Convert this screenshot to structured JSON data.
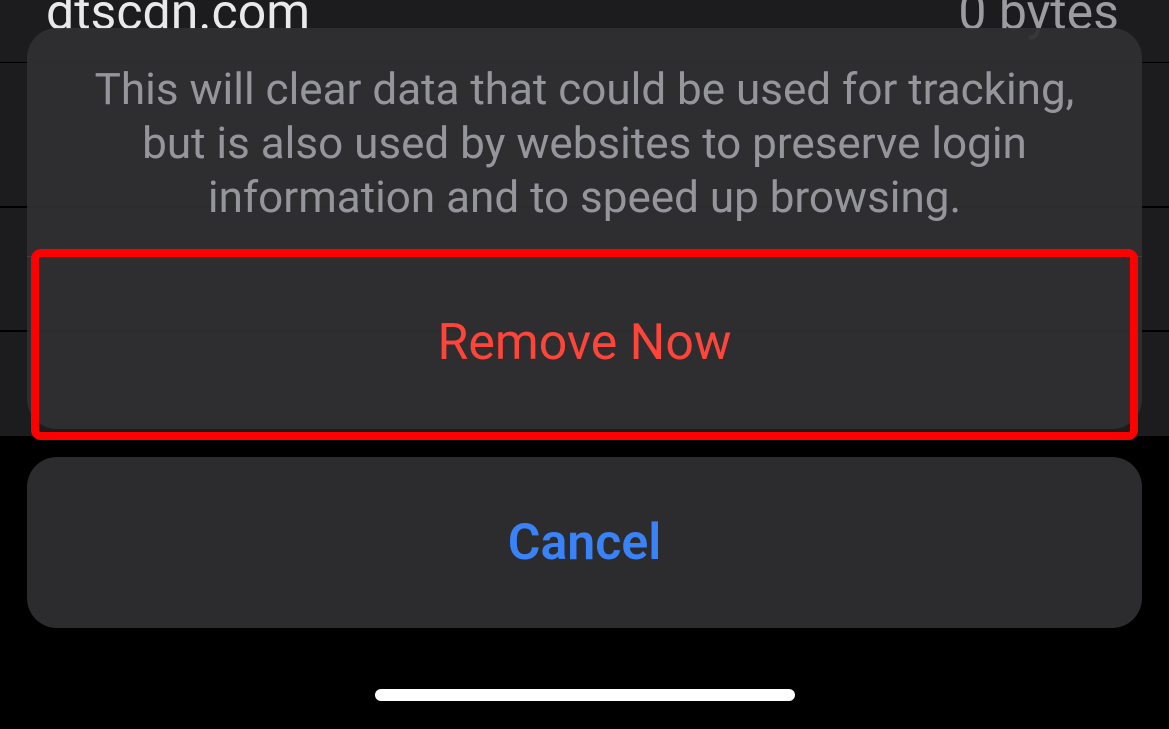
{
  "background_row": {
    "domain": "dtscdn.com",
    "size": "0 bytes"
  },
  "sheet": {
    "message": "This will clear data that could be used for tracking, but is also used by websites to preserve login information and to speed up browsing.",
    "remove_label": "Remove Now",
    "cancel_label": "Cancel"
  },
  "colors": {
    "destructive": "#ff453a",
    "accent_blue": "#3a82f7",
    "highlight_red": "#ff0000"
  }
}
